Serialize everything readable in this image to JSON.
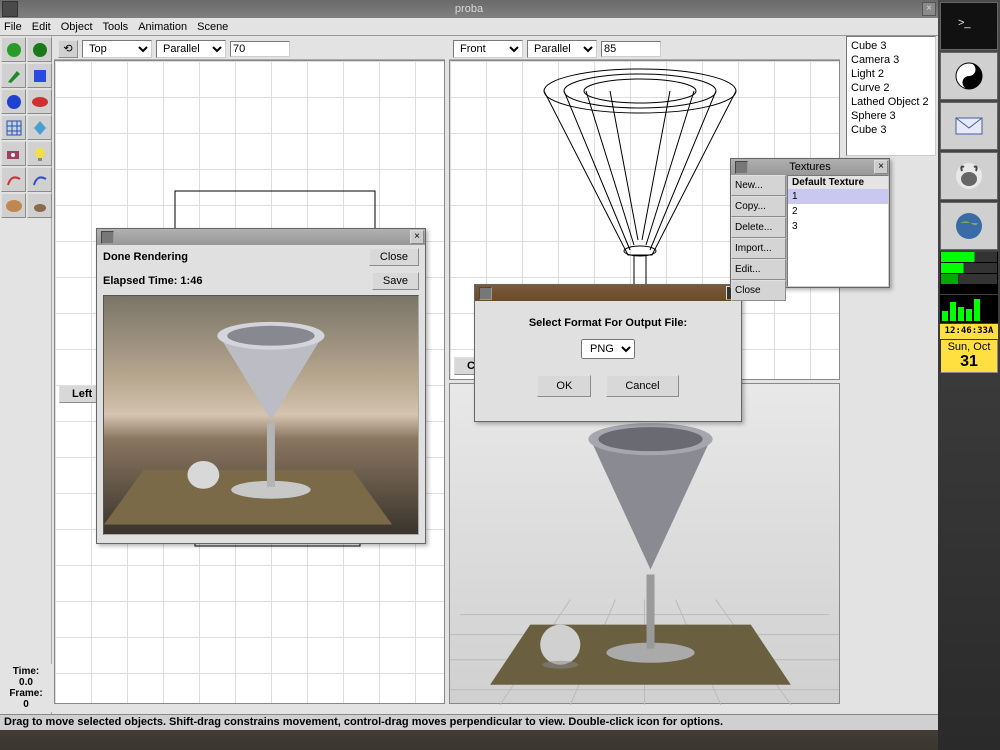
{
  "window": {
    "title": "proba"
  },
  "menubar": [
    "File",
    "Edit",
    "Object",
    "Tools",
    "Animation",
    "Scene"
  ],
  "viewport": {
    "left": {
      "view": "Top",
      "proj": "Parallel",
      "zoom": "70",
      "label": "Left"
    },
    "right": {
      "view": "Front",
      "proj": "Parallel",
      "zoom": "85",
      "label": "Came"
    }
  },
  "scene_objects": [
    "Cube 3",
    "Camera 3",
    "Light 2",
    "Curve 2",
    "Lathed Object 2",
    "Sphere 3",
    "Cube 3"
  ],
  "time_panel": {
    "time_label": "Time:",
    "time_value": "0.0",
    "frame_label": "Frame:",
    "frame_value": "0"
  },
  "statusbar": "Drag to move selected objects.  Shift-drag constrains movement, control-drag moves perpendicular to view.  Double-click icon for options.",
  "render_dialog": {
    "status": "Done Rendering",
    "elapsed": "Elapsed Time: 1:46",
    "close_label": "Close",
    "save_label": "Save"
  },
  "format_dialog": {
    "prompt": "Select Format For Output File:",
    "selected": "PNG",
    "ok_label": "OK",
    "cancel_label": "Cancel"
  },
  "textures_panel": {
    "title": "Textures",
    "buttons": [
      "New...",
      "Copy...",
      "Delete...",
      "Import...",
      "Edit...",
      "Close"
    ],
    "header": "Default Texture",
    "items": [
      "1",
      "2",
      "3"
    ],
    "selected_index": 0
  },
  "clock": {
    "time": "12:46:33A",
    "day": "Sun, Oct",
    "date": "31"
  },
  "tool_icons": [
    "sphere-green-icon",
    "sphere-green-b-icon",
    "brush-icon",
    "cube-icon",
    "sphere-blue-icon",
    "disc-red-icon",
    "grid-icon",
    "crystal-icon",
    "camera-icon",
    "light-icon",
    "curve-red-icon",
    "curve-blue-icon",
    "palette-icon",
    "teapot-icon"
  ]
}
